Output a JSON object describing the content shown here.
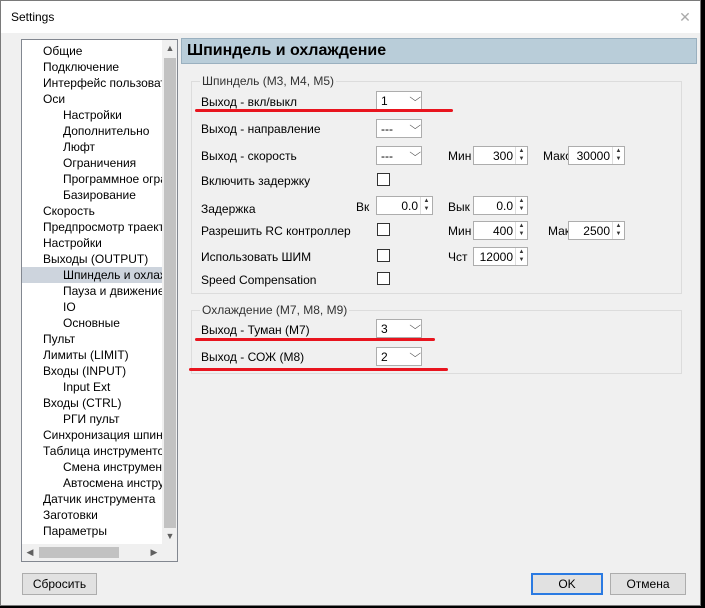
{
  "window": {
    "title": "Settings",
    "close_glyph": "✕"
  },
  "tree": {
    "items": [
      {
        "label": "Общие",
        "level": 0
      },
      {
        "label": "Подключение",
        "level": 0
      },
      {
        "label": "Интерфейс пользовате",
        "level": 0
      },
      {
        "label": "Оси",
        "level": 0
      },
      {
        "label": "Настройки",
        "level": 1
      },
      {
        "label": "Дополнительно",
        "level": 1
      },
      {
        "label": "Люфт",
        "level": 1
      },
      {
        "label": "Ограничения",
        "level": 1
      },
      {
        "label": "Программное огра",
        "level": 1
      },
      {
        "label": "Базирование",
        "level": 1
      },
      {
        "label": "Скорость",
        "level": 0
      },
      {
        "label": "Предпросмотр траекто",
        "level": 0
      },
      {
        "label": "Настройки",
        "level": 0
      },
      {
        "label": "Выходы (OUTPUT)",
        "level": 0
      },
      {
        "label": "Шпиндель и охлажд",
        "level": 1,
        "selected": true
      },
      {
        "label": "Пауза и движение",
        "level": 1
      },
      {
        "label": "IO",
        "level": 1
      },
      {
        "label": "Основные",
        "level": 1
      },
      {
        "label": "Пульт",
        "level": 0
      },
      {
        "label": "Лимиты (LIMIT)",
        "level": 0
      },
      {
        "label": "Входы (INPUT)",
        "level": 0
      },
      {
        "label": "Input Ext",
        "level": 1
      },
      {
        "label": "Входы (CTRL)",
        "level": 0
      },
      {
        "label": "РГИ пульт",
        "level": 1
      },
      {
        "label": "Синхронизация шпинде",
        "level": 0
      },
      {
        "label": "Таблица инструментов",
        "level": 0
      },
      {
        "label": "Смена инструмента",
        "level": 1
      },
      {
        "label": "Автосмена инструм",
        "level": 1
      },
      {
        "label": "Датчик инструмента",
        "level": 0
      },
      {
        "label": "Заготовки",
        "level": 0
      },
      {
        "label": "Параметры",
        "level": 0
      }
    ]
  },
  "panel": {
    "title": "Шпиндель и охлаждение",
    "spindle_group": {
      "title": "Шпиндель (M3, M4, M5)",
      "out_onoff_label": "Выход - вкл/выкл",
      "out_onoff_value": "1",
      "out_dir_label": "Выход - направление",
      "out_dir_value": "---",
      "out_speed_label": "Выход - скорость",
      "out_speed_value": "---",
      "speed_min_label": "Мин",
      "speed_min_value": "300",
      "speed_max_label": "Макс",
      "speed_max_value": "30000",
      "delay_enable_label": "Включить задержку",
      "delay_label": "Задержка",
      "delay_on_label": "Вк",
      "delay_on_value": "0.0",
      "delay_off_label": "Вык",
      "delay_off_value": "0.0",
      "rc_label": "Разрешить RC контроллер",
      "rc_min_label": "Мин",
      "rc_min_value": "400",
      "rc_max_label": "Мак",
      "rc_max_value": "2500",
      "pwm_label": "Использовать ШИМ",
      "pwm_freq_label": "Чст",
      "pwm_freq_value": "12000",
      "speed_comp_label": "Speed Compensation"
    },
    "cooling_group": {
      "title": "Охлаждение (M7, M8, M9)",
      "mist_label": "Выход - Туман (M7)",
      "mist_value": "3",
      "flood_label": "Выход - СОЖ (M8)",
      "flood_value": "2"
    }
  },
  "footer": {
    "reset_label": "Сбросить",
    "ok_label": "OK",
    "cancel_label": "Отмена"
  },
  "colors": {
    "annotation_red": "#e8141e",
    "header_bg": "#b9cdd9",
    "selection": "#cdd4dd"
  }
}
